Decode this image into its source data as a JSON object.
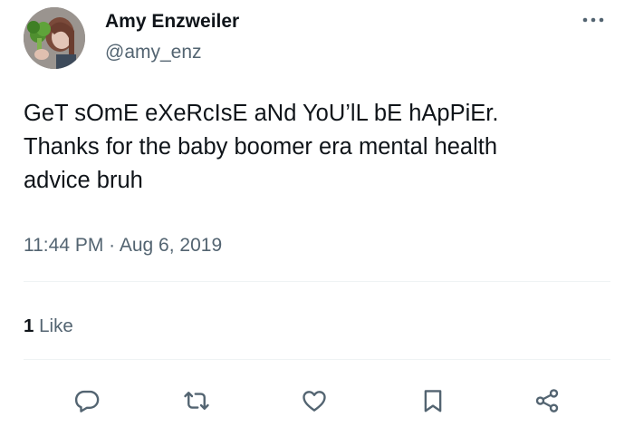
{
  "author": {
    "name": "Amy Enzweiler",
    "handle": "@amy_enz"
  },
  "tweet": {
    "lines": [
      "GeT sOmE eXeRcIsE aNd YoU’lL bE hApPiEr.",
      "Thanks for the baby boomer era mental health",
      "advice bruh"
    ],
    "time": "11:44 PM",
    "separator": "·",
    "date": "Aug 6, 2019"
  },
  "engagement": {
    "like_count": "1",
    "like_label": "Like"
  },
  "icons": {
    "more": "more-horizontal-icon",
    "reply": "reply-icon",
    "retweet": "retweet-icon",
    "like": "heart-icon",
    "bookmark": "bookmark-icon",
    "share": "share-icon"
  },
  "colors": {
    "text_primary": "#0f1419",
    "text_secondary": "#536471",
    "divider": "#eff3f4",
    "background": "#ffffff"
  }
}
